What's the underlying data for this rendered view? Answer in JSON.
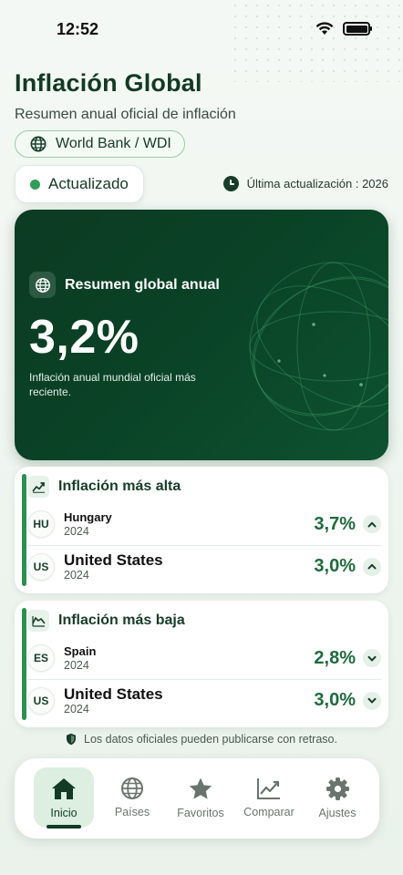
{
  "status_bar": {
    "time": "12:52"
  },
  "header": {
    "title": "Inflación Global",
    "subtitle": "Resumen anual oficial de inflación",
    "source": "World Bank / WDI",
    "status": "Actualizado",
    "last_update": "Última actualización : 2026"
  },
  "hero": {
    "heading": "Resumen global anual",
    "value": "3,2%",
    "description": "Inflación anual mundial oficial más reciente."
  },
  "highest": {
    "heading": "Inflación más alta",
    "rows": [
      {
        "code": "HU",
        "country": "Hungary",
        "year": "2024",
        "value": "3,7%",
        "trend": "up"
      },
      {
        "code": "US",
        "country": "United States",
        "year": "2024",
        "value": "3,0%",
        "trend": "up"
      }
    ]
  },
  "lowest": {
    "heading": "Inflación más baja",
    "rows": [
      {
        "code": "ES",
        "country": "Spain",
        "year": "2024",
        "value": "2,8%",
        "trend": "down"
      },
      {
        "code": "US",
        "country": "United States",
        "year": "2024",
        "value": "3,0%",
        "trend": "down"
      }
    ]
  },
  "note": "Los datos oficiales pueden publicarse con retraso.",
  "tabs": [
    {
      "label": "Inicio",
      "icon": "home-icon",
      "active": true
    },
    {
      "label": "Países",
      "icon": "globe-icon",
      "active": false
    },
    {
      "label": "Favoritos",
      "icon": "star-icon",
      "active": false
    },
    {
      "label": "Comparar",
      "icon": "chart-icon",
      "active": false
    },
    {
      "label": "Ajustes",
      "icon": "gear-icon",
      "active": false
    }
  ],
  "colors": {
    "primary": "#123a24",
    "accent": "#2f9e57",
    "hero_bg": "#0a4226"
  }
}
